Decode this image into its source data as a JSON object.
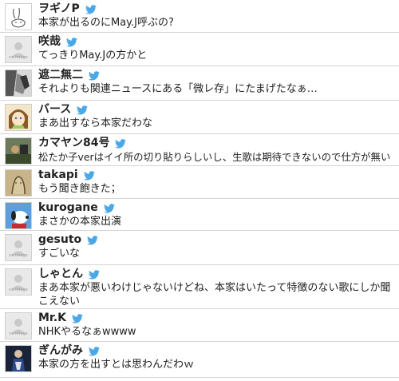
{
  "tweets": [
    {
      "name": "ヲギノP",
      "text": "本家が出るのにMay.J呼ぶの?",
      "avatar": "rabbit-drawing-avatar"
    },
    {
      "name": "咲哉",
      "text": "てっきりMay.Jの方かと",
      "avatar": "no-image-avatar",
      "avatar_label": "no image"
    },
    {
      "name": "遮二無二",
      "text": "それよりも関連ニュースにある「微レ存」にたまげたなぁ…",
      "avatar": "manga-avatar"
    },
    {
      "name": "バース",
      "text": "まあ出すなら本家だわな",
      "avatar": "anime-girl-avatar"
    },
    {
      "name": "カマヤン84号",
      "text": "松たか子verはイイ所の切り貼りらしいし、生歌は期待できないので仕方が無い",
      "avatar": "game-scene-avatar"
    },
    {
      "name": "takapi",
      "text": "もう聞き飽きた；",
      "avatar": "sketch-avatar"
    },
    {
      "name": "kurogane",
      "text": "まさかの本家出演",
      "avatar": "snoopy-avatar"
    },
    {
      "name": "gesuto",
      "text": "すごいな",
      "avatar": "no-image-avatar",
      "avatar_label": "no image"
    },
    {
      "name": "しゃとん",
      "text": "まあ本家が悪いわけじゃないけどね、本家はいたって特徴のない歌にしか聞こえない",
      "avatar": "no-image-avatar",
      "avatar_label": "no image"
    },
    {
      "name": "Mr.K",
      "text": "NHKやるなぁwwww",
      "avatar": "no-image-avatar",
      "avatar_label": "no image"
    },
    {
      "name": "ぎんがみ",
      "text": "本家の方を出すとは思わんだわｗ",
      "avatar": "dark-figure-avatar"
    }
  ],
  "colors": {
    "twitter_blue": "#4aa8e8",
    "divider": "#d4d4d4",
    "text": "#222222"
  }
}
